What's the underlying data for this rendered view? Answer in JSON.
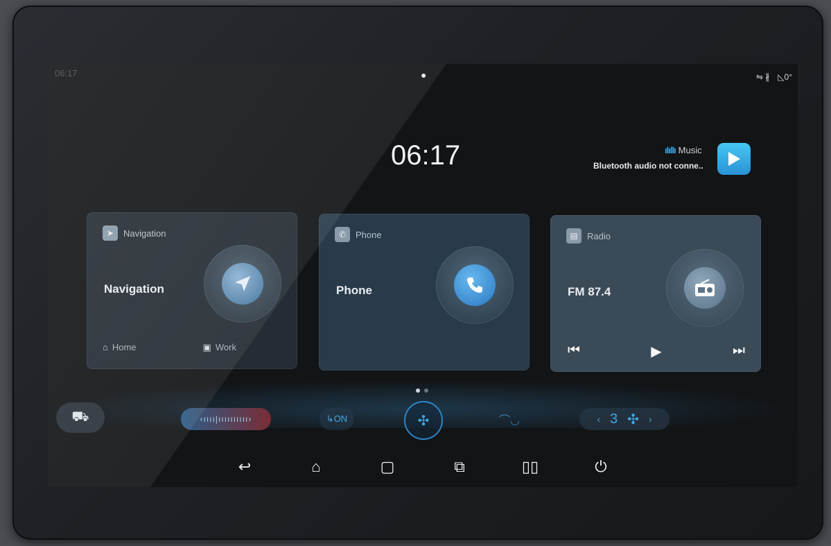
{
  "status": {
    "time": "06:17",
    "right_icons": "⇋ ∦",
    "signal": "◺0°"
  },
  "clock": "06:17",
  "music": {
    "label": "Music",
    "bars": "ılıllı",
    "status": "Bluetooth audio not conne.."
  },
  "cards": {
    "navigation": {
      "header": "Navigation",
      "title": "Navigation",
      "home": "Home",
      "work": "Work"
    },
    "phone": {
      "header": "Phone",
      "title": "Phone"
    },
    "radio": {
      "header": "Radio",
      "title": "FM 87.4"
    }
  },
  "climate": {
    "temp_bar": "‹ıııı|ıııııııııı›",
    "recirc": "↳ON",
    "fan_speed": "3"
  },
  "page_dots": {
    "count": 2,
    "active": 0
  },
  "icons": [
    "car-icon",
    "fan-icon",
    "back-icon",
    "home-icon",
    "recents-icon",
    "split-icon",
    "power-icon",
    "play-icon",
    "prev-icon",
    "next-icon",
    "phone-icon",
    "navigation-arrow-icon",
    "radio-icon"
  ],
  "colors": {
    "accent": "#3fa8e6",
    "music_button": "#3fb6ee"
  }
}
